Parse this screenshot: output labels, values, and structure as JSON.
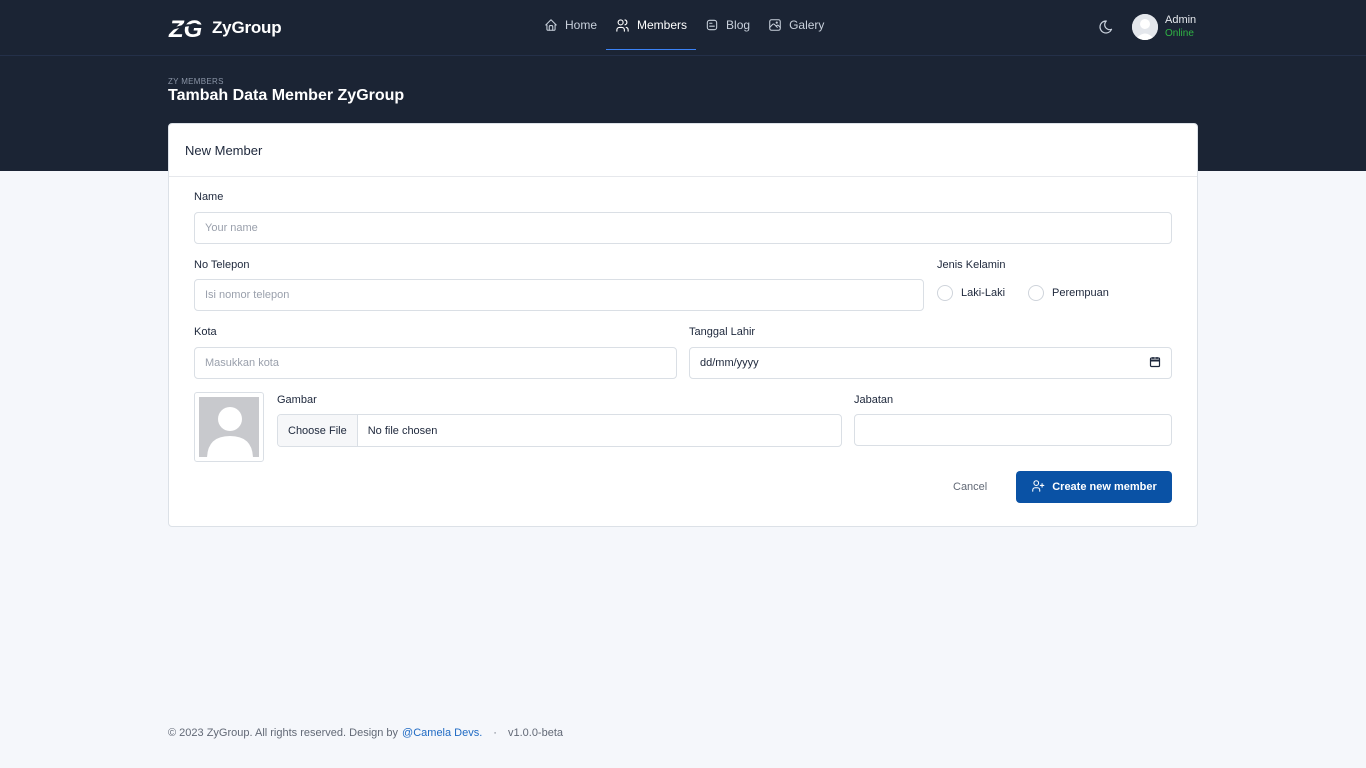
{
  "brand": {
    "logo_text": "ZG",
    "name": "ZyGroup"
  },
  "nav": {
    "items": [
      {
        "label": "Home",
        "icon": "home-icon"
      },
      {
        "label": "Members",
        "icon": "users-icon",
        "active": true
      },
      {
        "label": "Blog",
        "icon": "blog-icon"
      },
      {
        "label": "Galery",
        "icon": "photo-icon"
      }
    ]
  },
  "theme_toggle": {
    "icon": "moon-icon"
  },
  "user": {
    "name": "Admin",
    "status": "Online",
    "status_color": "#2fb344"
  },
  "header": {
    "pretitle": "ZY MEMBERS",
    "title": "Tambah Data Member ZyGroup"
  },
  "card": {
    "title": "New Member"
  },
  "form": {
    "name": {
      "label": "Name",
      "placeholder": "Your name"
    },
    "phone": {
      "label": "No Telepon",
      "placeholder": "Isi nomor telepon"
    },
    "gender": {
      "label": "Jenis Kelamin",
      "options": [
        "Laki-Laki",
        "Perempuan"
      ]
    },
    "city": {
      "label": "Kota",
      "placeholder": "Masukkan kota"
    },
    "birthdate": {
      "label": "Tanggal Lahir",
      "placeholder": "dd/mm/yyyy"
    },
    "image": {
      "label": "Gambar",
      "button_label": "Choose File",
      "status": "No file chosen"
    },
    "position": {
      "label": "Jabatan",
      "value": ""
    },
    "cancel_label": "Cancel",
    "submit_label": "Create new member"
  },
  "footer": {
    "copyright": "© 2023 ZyGroup. All rights reserved. Design by",
    "author_link": "@Camela Devs.",
    "separator": "·",
    "version": "v1.0.0-beta"
  },
  "colors": {
    "navbar_bg": "#1b2434",
    "primary": "#0a52a5",
    "page_bg": "#f5f7fb"
  }
}
